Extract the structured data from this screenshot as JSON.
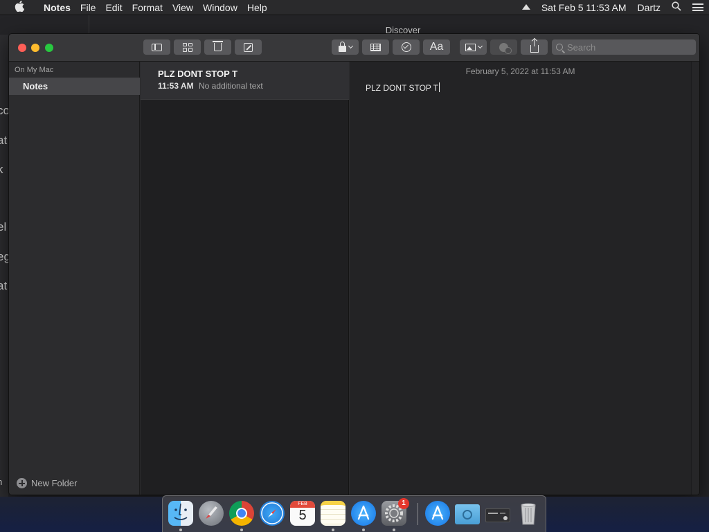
{
  "menubar": {
    "apple": "",
    "app": "Notes",
    "menus": [
      "File",
      "Edit",
      "Format",
      "View",
      "Window",
      "Help"
    ],
    "datetime": "Sat Feb 5  11:53 AM",
    "user": "Dartz"
  },
  "background_window": {
    "title": "Discover",
    "fragments": [
      "co",
      "at",
      "k",
      "el",
      "eg",
      "at",
      "n"
    ]
  },
  "toolbar": {
    "search_placeholder": "Search",
    "font_button": "Aa"
  },
  "sidebar": {
    "section": "On My Mac",
    "folders": [
      {
        "label": "Notes",
        "selected": true
      }
    ],
    "new_folder": "New Folder"
  },
  "note_list": [
    {
      "title": "PLZ DONT STOP T",
      "time": "11:53 AM",
      "preview": "No additional text",
      "selected": true
    }
  ],
  "editor": {
    "date": "February 5, 2022 at 11:53 AM",
    "body": "PLZ DONT STOP T"
  },
  "dock": {
    "calendar_month": "FEB",
    "calendar_day": "5",
    "badge_count": "1",
    "apps": [
      "finder-icon",
      "launchpad-icon",
      "chrome-icon",
      "safari-icon",
      "calendar-icon",
      "notes-icon",
      "app-store-icon",
      "system-preferences-icon",
      "app-store-download-icon",
      "folder-icon",
      "screenshot-icon",
      "trash-icon"
    ]
  },
  "colors": {
    "close": "#fe5f57",
    "minimize": "#febc2e",
    "zoom": "#28c840",
    "selected_folder": "#464649",
    "window_bg": "#2b2b2d",
    "badge": "#e5362d"
  }
}
